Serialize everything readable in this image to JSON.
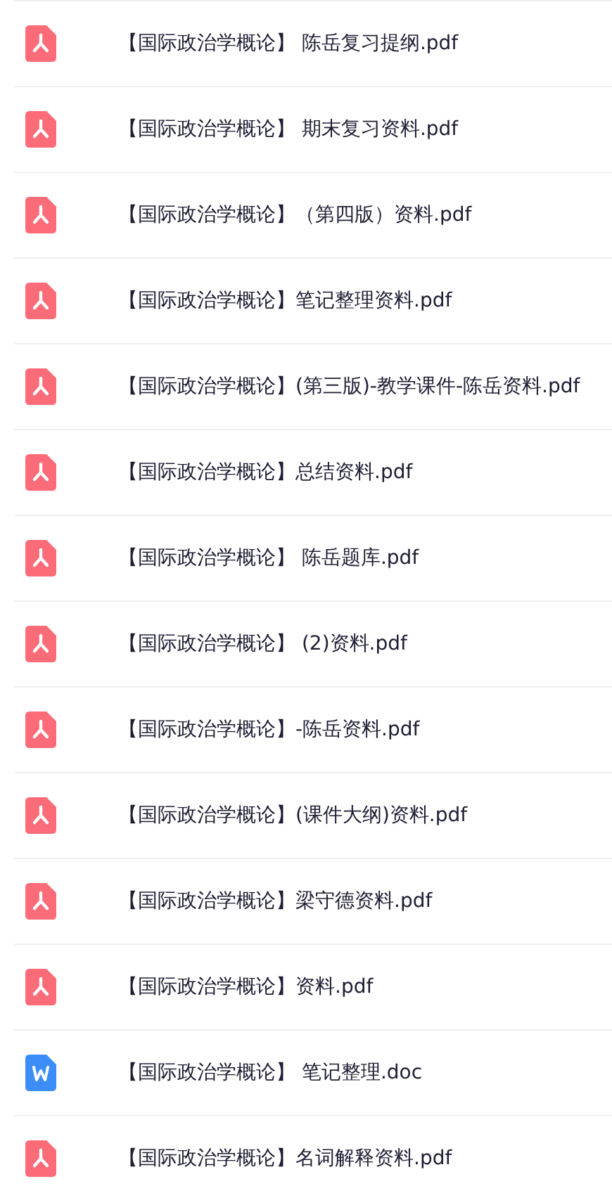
{
  "files": [
    {
      "kind": "pdf",
      "name": "【国际政治学概论】 陈岳复习提纲.pdf"
    },
    {
      "kind": "pdf",
      "name": "【国际政治学概论】 期末复习资料.pdf"
    },
    {
      "kind": "pdf",
      "name": "【国际政治学概论】（第四版）资料.pdf"
    },
    {
      "kind": "pdf",
      "name": "【国际政治学概论】笔记整理资料.pdf"
    },
    {
      "kind": "pdf",
      "name": "【国际政治学概论】(第三版)-教学课件-陈岳资料.pdf"
    },
    {
      "kind": "pdf",
      "name": "【国际政治学概论】总结资料.pdf"
    },
    {
      "kind": "pdf",
      "name": "【国际政治学概论】 陈岳题库.pdf"
    },
    {
      "kind": "pdf",
      "name": "【国际政治学概论】 (2)资料.pdf"
    },
    {
      "kind": "pdf",
      "name": "【国际政治学概论】-陈岳资料.pdf"
    },
    {
      "kind": "pdf",
      "name": "【国际政治学概论】(课件大纲)资料.pdf"
    },
    {
      "kind": "pdf",
      "name": "【国际政治学概论】梁守德资料.pdf"
    },
    {
      "kind": "pdf",
      "name": "【国际政治学概论】资料.pdf"
    },
    {
      "kind": "doc",
      "name": "【国际政治学概论】 笔记整理.doc"
    },
    {
      "kind": "pdf",
      "name": "【国际政治学概论】名词解释资料.pdf"
    }
  ]
}
